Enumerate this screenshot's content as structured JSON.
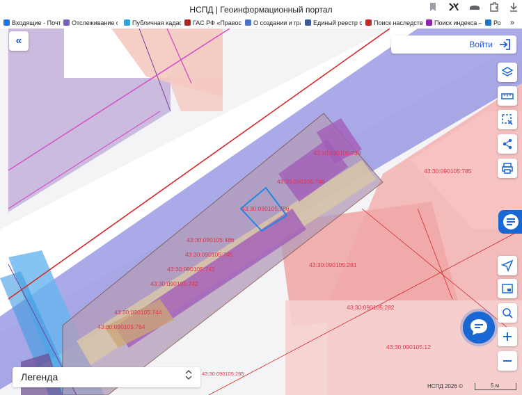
{
  "browser": {
    "title": "НСПД | Геоинформационный портал",
    "bookmarks": [
      {
        "label": "Входящие - Почта",
        "color": "#1a73e8"
      },
      {
        "label": "Отслеживание от",
        "color": "#7b5cc4"
      },
      {
        "label": "Публичная кадаст",
        "color": "#33a0d6"
      },
      {
        "label": "ГАС РФ «Правосу",
        "color": "#b22222"
      },
      {
        "label": "О создании и гра",
        "color": "#4a73c7"
      },
      {
        "label": "Единый реестр су",
        "color": "#3d5a99"
      },
      {
        "label": "Поиск наследстве",
        "color": "#c62828"
      },
      {
        "label": "Поиск индекса — ",
        "color": "#8e24aa"
      },
      {
        "label": "Ро",
        "color": "#1976d2"
      }
    ],
    "more_bookmarks": "»"
  },
  "map": {
    "login_label": "Войти",
    "legend_label": "Легенда",
    "legend_toggle": "⌃⌄",
    "attribution": "НСПД 2026 ©",
    "scale": "5 м",
    "parcels": [
      {
        "id": "43:30:090105:739"
      },
      {
        "id": "43:30:090105:740"
      },
      {
        "id": "43:30:090105:785"
      },
      {
        "id": "43:30:090105:786"
      },
      {
        "id": "43:30:090105:486"
      },
      {
        "id": "43:30:090105:745"
      },
      {
        "id": "43:30:090105:743"
      },
      {
        "id": "43:30:090105:742"
      },
      {
        "id": "43:30:090105:281"
      },
      {
        "id": "43:30:090105:282"
      },
      {
        "id": "43:30:090105:744"
      },
      {
        "id": "43:30:090105:764"
      },
      {
        "id": "43:30:090105:12"
      },
      {
        "id": "43:30:090105:285"
      }
    ]
  },
  "colors": {
    "accent": "#1967d2",
    "parcel_label": "#e0354a"
  }
}
